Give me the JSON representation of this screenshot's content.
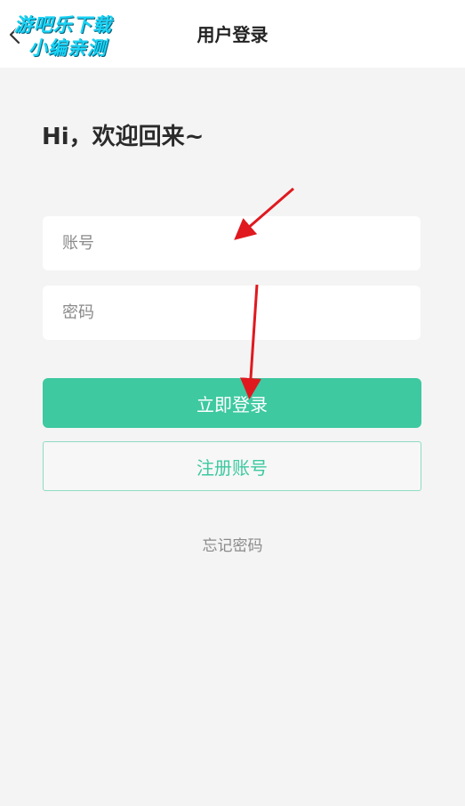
{
  "watermark": {
    "line1": "游吧乐下载",
    "line2": "小编亲测"
  },
  "header": {
    "title": "用户登录",
    "back_icon": "chevron-left-icon"
  },
  "greeting": "Hi，欢迎回来~",
  "form": {
    "account_placeholder": "账号",
    "account_value": "",
    "password_placeholder": "密码",
    "password_value": ""
  },
  "buttons": {
    "login_label": "立即登录",
    "register_label": "注册账号"
  },
  "links": {
    "forgot_password": "忘记密码"
  },
  "colors": {
    "accent": "#3ec9a0",
    "background": "#f4f4f4",
    "annotation_arrow": "#e0191f"
  }
}
